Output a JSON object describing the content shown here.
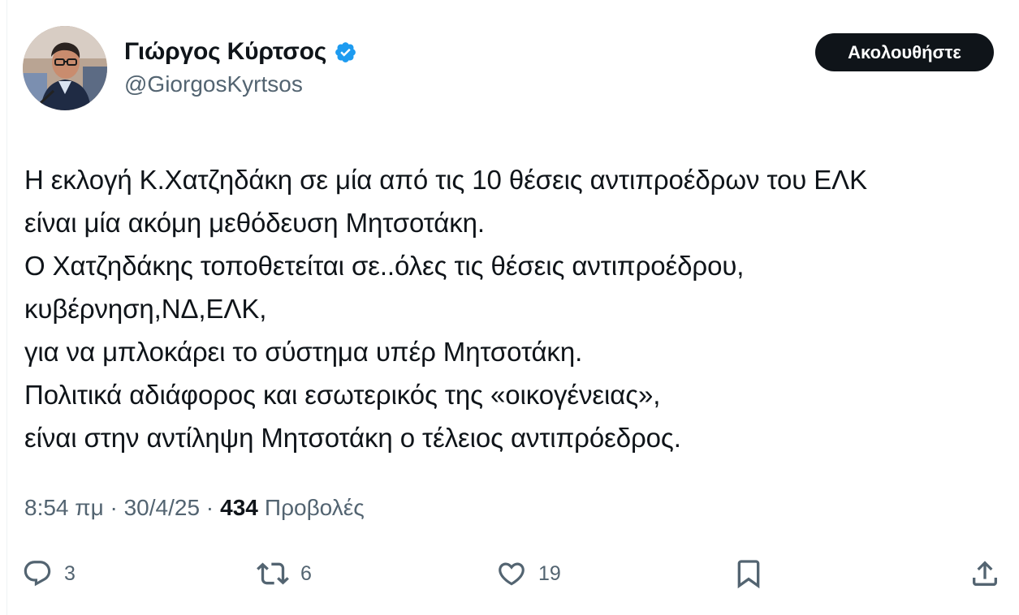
{
  "author": {
    "display_name": "Γιώργος Κύρτσος",
    "handle": "@GiorgosKyrtsos",
    "verified": true
  },
  "follow_button": {
    "label": "Ακολουθήστε"
  },
  "tweet": {
    "lines": [
      "Η εκλογή Κ.Χατζηδάκη σε μία από τις 10 θέσεις αντιπροέδρων του ΕΛΚ",
      "είναι μία ακόμη μεθόδευση Μητσοτάκη.",
      "Ο Χατζηδάκης τοποθετείται σε..όλες τις θέσεις αντιπροέδρου,",
      "κυβέρνηση,ΝΔ,ΕΛΚ,",
      "για να μπλοκάρει το σύστημα υπέρ Μητσοτάκη.",
      "Πολιτικά αδιάφορος και εσωτερικός της «οικογένειας»,",
      "είναι στην αντίληψη Μητσοτάκη ο τέλειος αντιπρόεδρος."
    ]
  },
  "meta": {
    "time_date": "8:54 πμ · 30/4/25 ·",
    "views_count": "434",
    "views_label": "Προβολές"
  },
  "actions": {
    "reply": {
      "icon": "reply-icon",
      "count": "3"
    },
    "retweet": {
      "icon": "retweet-icon",
      "count": "6"
    },
    "like": {
      "icon": "heart-icon",
      "count": "19"
    },
    "bookmark": {
      "icon": "bookmark-icon"
    },
    "share": {
      "icon": "share-icon"
    }
  },
  "colors": {
    "text_primary": "#0f1419",
    "text_secondary": "#536471",
    "verified_blue": "#1d9bf0",
    "button_bg": "#0f1419",
    "button_text": "#ffffff"
  }
}
